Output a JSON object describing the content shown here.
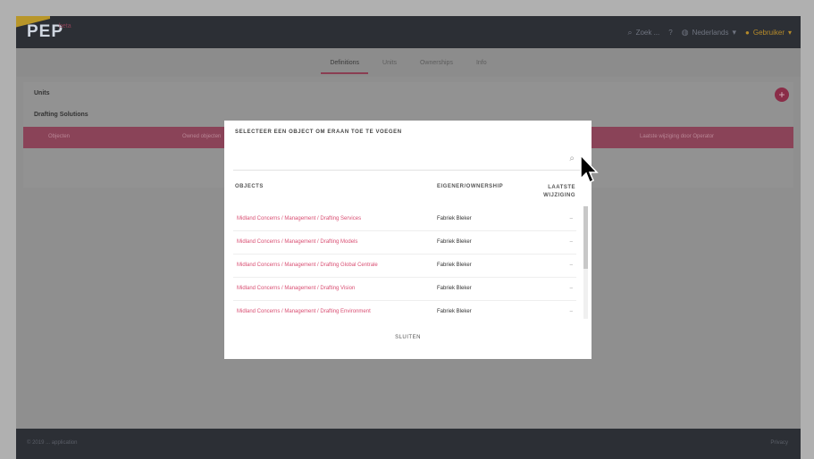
{
  "app": {
    "logo": "PEP",
    "logo_sup": "beta"
  },
  "nav": {
    "search_label": "Zoek ...",
    "help_label": "?",
    "language_label": "Nederlands",
    "user_label": "Gebruiker"
  },
  "tabs": [
    {
      "label": "Definitions",
      "active": true
    },
    {
      "label": "Units",
      "active": false
    },
    {
      "label": "Ownerships",
      "active": false
    },
    {
      "label": "Info",
      "active": false
    }
  ],
  "card": {
    "title": "Units",
    "subtitle": "Drafting Solutions",
    "band_left": "Objecten",
    "band_mid": "Owned objecten",
    "band_right": "Laatste wijziging door Operator"
  },
  "modal": {
    "title": "SELECTEER EEN OBJECT OM ERAAN TOE TE VOEGEN",
    "search_placeholder": "",
    "headers": {
      "object": "OBJECTS",
      "owner": "EIGENER/OWNERSHIP",
      "last": "LAATSTE WIJZIGING"
    },
    "rows": [
      {
        "object": "Midland Concerns / Management / Drafting Services",
        "owner": "Fabriek Bleker",
        "last": "–"
      },
      {
        "object": "Midland Concerns / Management / Drafting Models",
        "owner": "Fabriek Bleker",
        "last": "–"
      },
      {
        "object": "Midland Concerns / Management / Drafting Global Centrale",
        "owner": "Fabriek Bleker",
        "last": "–"
      },
      {
        "object": "Midland Concerns / Management / Drafting Vision",
        "owner": "Fabriek Bleker",
        "last": "–"
      },
      {
        "object": "Midland Concerns / Management / Drafting Environment",
        "owner": "Fabriek Bleker",
        "last": "–"
      }
    ],
    "close_label": "SLUITEN"
  },
  "footer": {
    "left": "© 2019 ... application",
    "right": "Privacy"
  },
  "colors": {
    "accent": "#d94f73",
    "topbar": "#2c2f35"
  }
}
